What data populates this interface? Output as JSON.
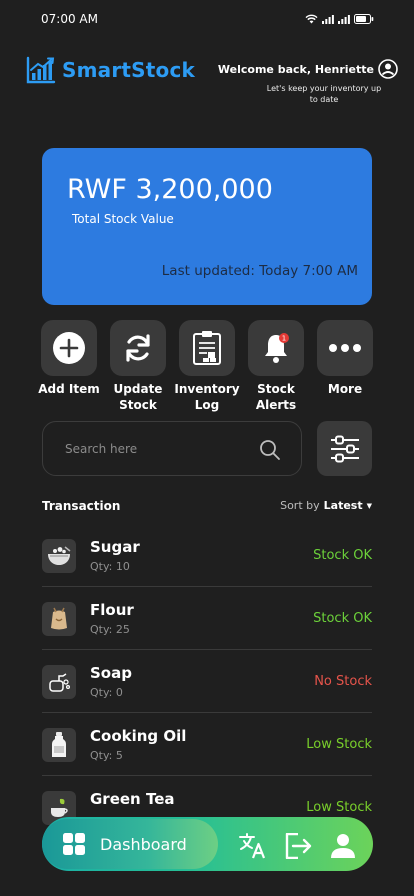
{
  "status_bar": {
    "time": "07:00 AM"
  },
  "header": {
    "brand": "SmartStock",
    "welcome": "Welcome back, Henriette",
    "subtitle": "Let's keep your inventory up to date"
  },
  "summary": {
    "amount": "RWF 3,200,000",
    "label": "Total Stock Value",
    "updated": "Last updated: Today 7:00 AM"
  },
  "actions": [
    {
      "label": "Add Item",
      "icon": "plus-circle-icon"
    },
    {
      "label": "Update Stock",
      "icon": "refresh-icon"
    },
    {
      "label": "Inventory Log",
      "icon": "clipboard-icon"
    },
    {
      "label": "Stock Alerts",
      "icon": "bell-icon",
      "badge": "1"
    },
    {
      "label": "More",
      "icon": "more-dots-icon"
    }
  ],
  "search": {
    "placeholder": "Search here"
  },
  "transactions": {
    "title": "Transaction",
    "sort_label": "Sort by",
    "sort_value": "Latest",
    "items": [
      {
        "name": "Sugar",
        "qty": "Qty: 10",
        "status": "Stock OK",
        "status_color": "#6cd13a"
      },
      {
        "name": "Flour",
        "qty": "Qty: 25",
        "status": "Stock OK",
        "status_color": "#6cd13a"
      },
      {
        "name": "Soap",
        "qty": "Qty: 0",
        "status": "No Stock",
        "status_color": "#e5544b"
      },
      {
        "name": "Cooking Oil",
        "qty": "Qty: 5",
        "status": "Low Stock",
        "status_color": "#79cf2b"
      },
      {
        "name": "Green Tea",
        "qty": "",
        "status": "Low Stock",
        "status_color": "#79cf2b"
      }
    ]
  },
  "bottom_nav": {
    "home_label": "Dashboard",
    "icons": [
      "translate-icon",
      "logout-icon",
      "profile-icon"
    ]
  },
  "colors": {
    "brand": "#2d9cf4",
    "card": "#2d7be0",
    "background": "#1f1f1f"
  }
}
